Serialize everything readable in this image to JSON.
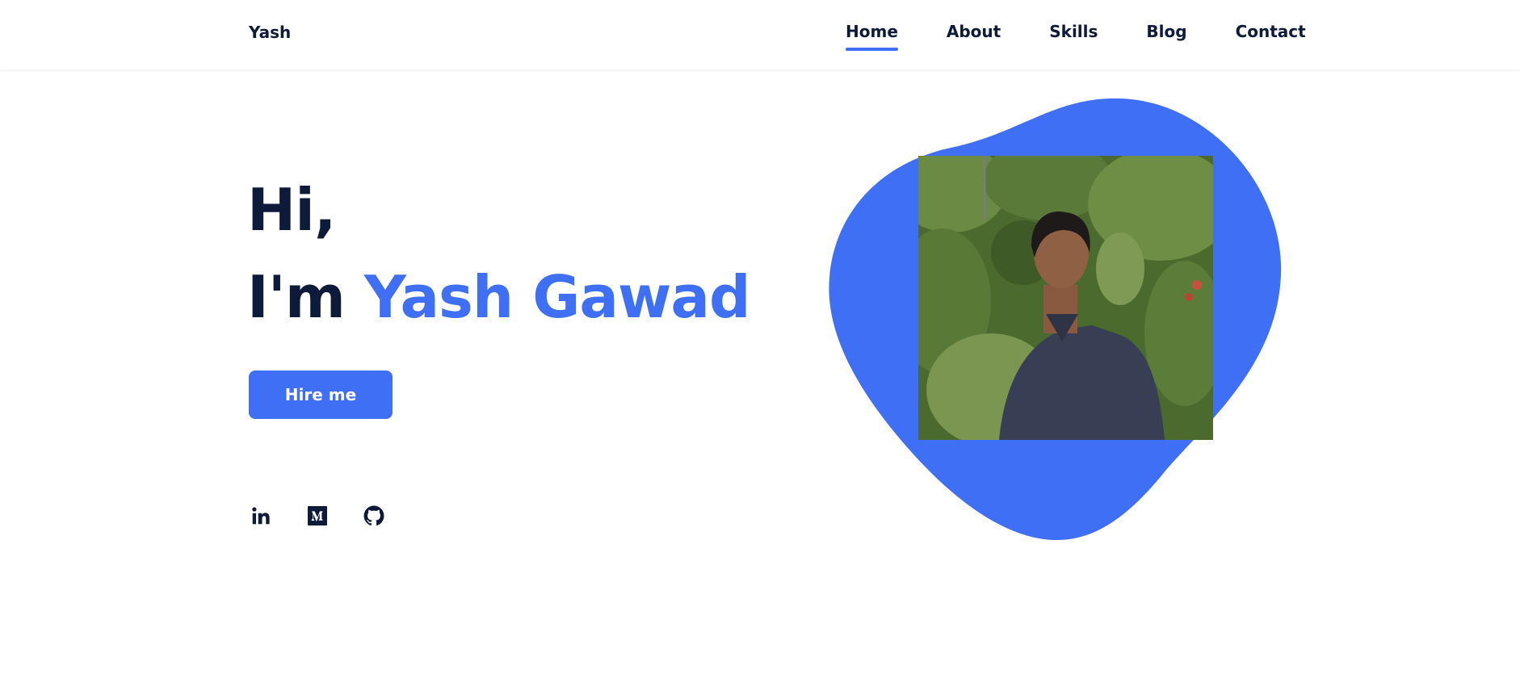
{
  "header": {
    "logo": "Yash",
    "nav": [
      {
        "label": "Home",
        "active": true
      },
      {
        "label": "About",
        "active": false
      },
      {
        "label": "Skills",
        "active": false
      },
      {
        "label": "Blog",
        "active": false
      },
      {
        "label": "Contact",
        "active": false
      }
    ]
  },
  "hero": {
    "greeting": "Hi,",
    "intro_prefix": "I'm ",
    "name": "Yash Gawad",
    "cta_label": "Hire me"
  },
  "social": [
    {
      "icon": "linkedin-icon"
    },
    {
      "icon": "medium-icon"
    },
    {
      "icon": "github-icon"
    }
  ],
  "colors": {
    "accent": "#3f6ff4",
    "text_dark": "#0e1a3a",
    "background": "#ffffff"
  }
}
